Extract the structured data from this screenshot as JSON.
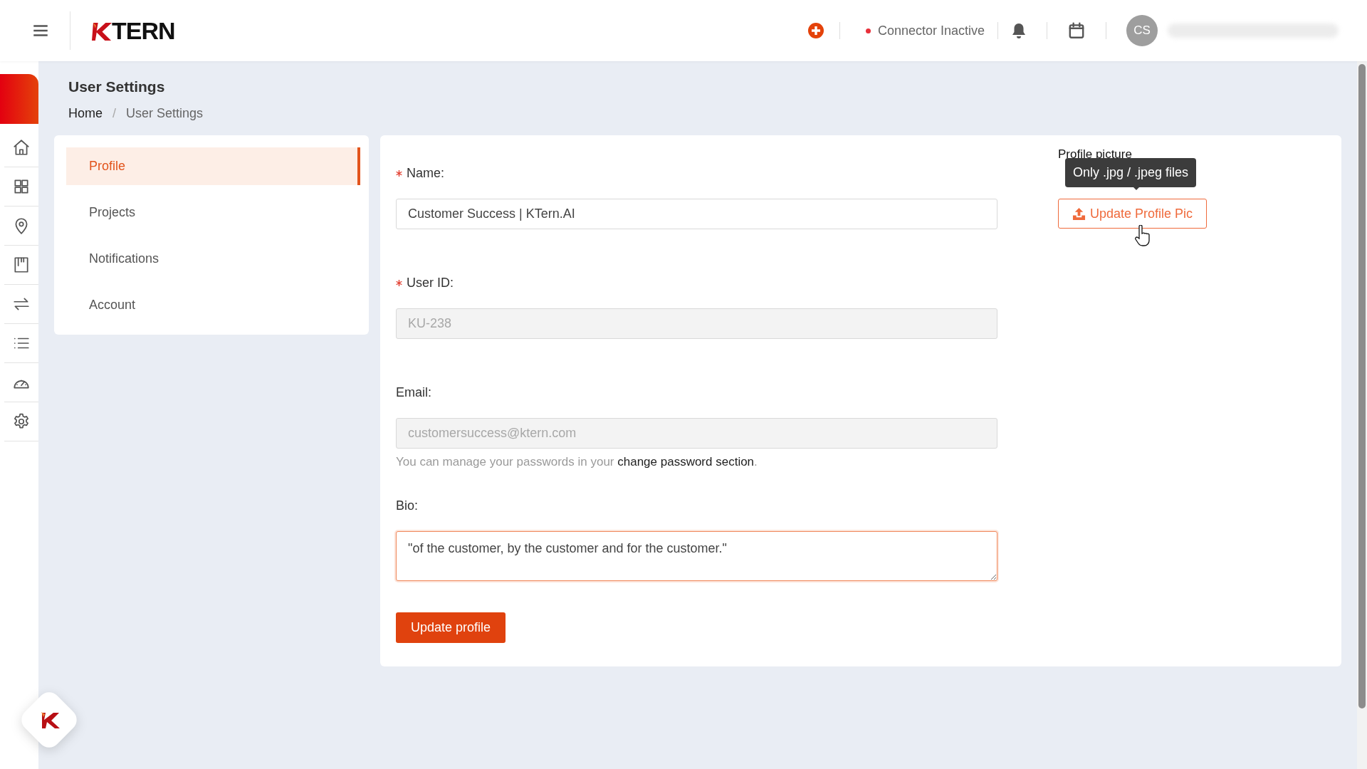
{
  "header": {
    "logo_text": "TERN",
    "connector_active": false,
    "connector_status": "Connector Inactive",
    "avatar_initials": "CS"
  },
  "page": {
    "title": "User Settings",
    "breadcrumb": [
      {
        "label": "Home",
        "current": false
      },
      {
        "label": "User Settings",
        "current": true
      }
    ],
    "breadcrumb_separator": "/"
  },
  "settings_menu": [
    {
      "label": "Profile",
      "selected": true
    },
    {
      "label": "Projects",
      "selected": false
    },
    {
      "label": "Notifications",
      "selected": false
    },
    {
      "label": "Account",
      "selected": false
    }
  ],
  "form": {
    "fields": [
      {
        "kind": "input",
        "label": "Name:",
        "required": true,
        "value": "Customer Success | KTern.AI",
        "disabled": false
      },
      {
        "kind": "input",
        "label": "User ID:",
        "required": true,
        "value": "KU-238",
        "disabled": true
      },
      {
        "kind": "input",
        "label": "Email:",
        "required": false,
        "value": "customersuccess@ktern.com",
        "disabled": true,
        "help": {
          "before": "You can manage your passwords in your ",
          "link": "change password section",
          "after": "."
        }
      },
      {
        "kind": "textarea",
        "label": "Bio:",
        "required": false,
        "value": "\"of the customer, by the customer and for the customer.\"",
        "disabled": false,
        "focused": true
      }
    ],
    "submit": "Update profile"
  },
  "profile_picture": {
    "label": "Profile picture",
    "button": "Update Profile Pic",
    "tooltip": "Only .jpg / .jpeg files"
  }
}
